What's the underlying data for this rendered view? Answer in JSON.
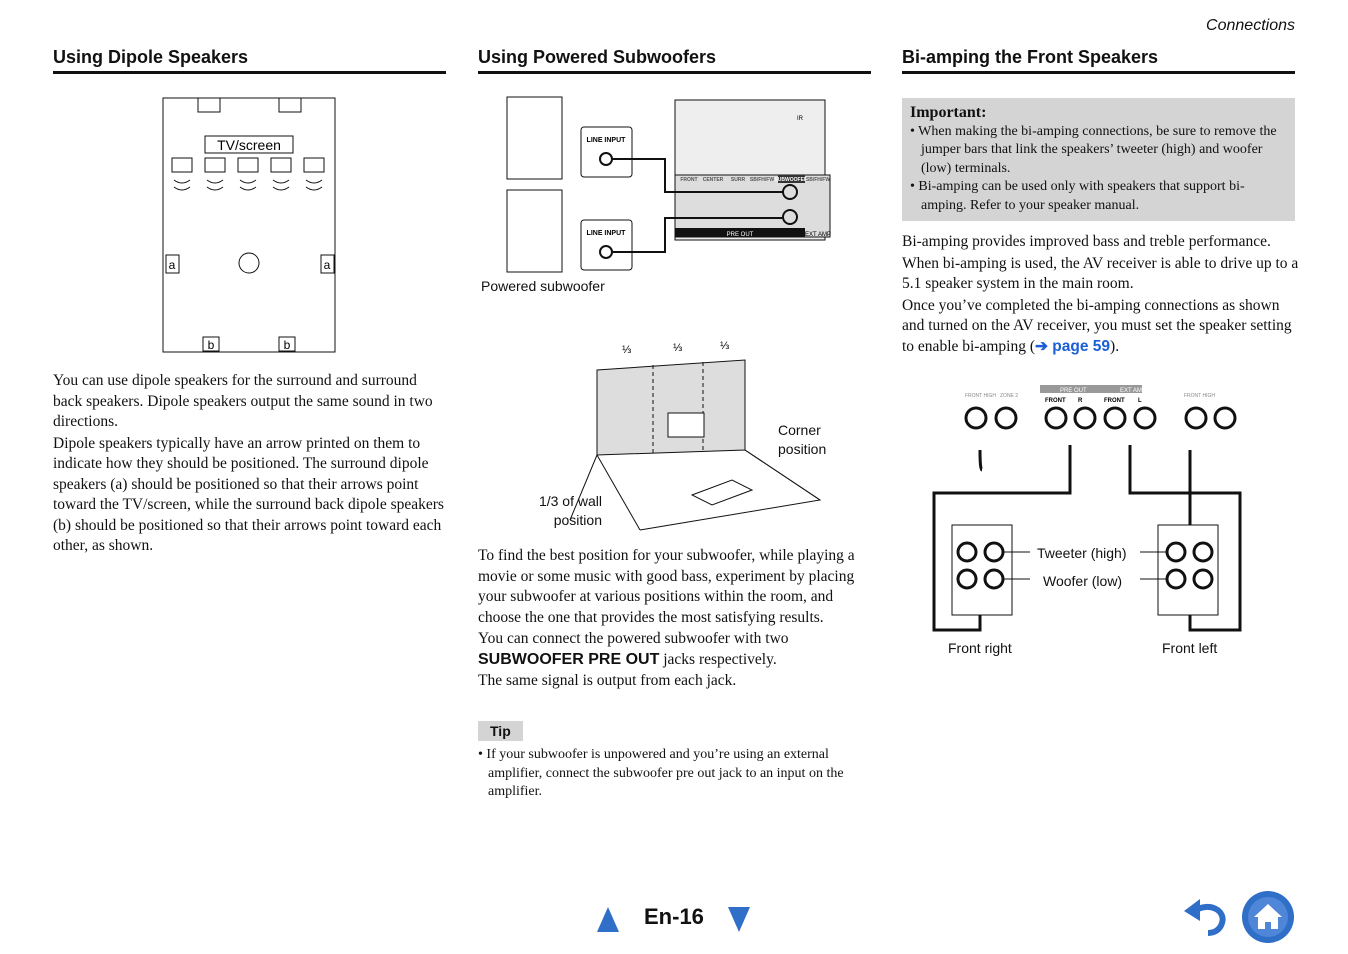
{
  "page": {
    "section": "Connections",
    "number": "En-16"
  },
  "colors": {
    "accent": "#1a5fd6",
    "note_bg": "#d4d4d4",
    "nav_blue": "#2f6fc8"
  },
  "dipole": {
    "title": "Using Dipole Speakers",
    "diagram": {
      "screen": "TV/screen",
      "label_a": "a",
      "label_b": "b"
    },
    "paragraphs": [
      "You can use dipole speakers for the surround and surround back speakers. Dipole speakers output the same sound in two directions.",
      "Dipole speakers typically have an arrow printed on them to indicate how they should be positioned. The surround dipole speakers (a) should be positioned so that their arrows point toward the TV/screen, while the surround back dipole speakers (b) should be positioned so that their arrows point toward each other, as shown."
    ]
  },
  "subwoofer": {
    "title": "Using Powered Subwoofers",
    "diagram": {
      "line_input": "LINE INPUT",
      "caption": "Powered subwoofer",
      "pre_out": "PRE OUT",
      "ext_amp": "EXT AMP",
      "ir": "IR",
      "jacks": [
        "FRONT",
        "CENTER",
        "SURR",
        "SB/FH/FW",
        "SUBWOOFER",
        "SB/FH/FW"
      ]
    },
    "room": {
      "third": "⅓",
      "corner": "Corner position",
      "wall": "1/3 of wall position"
    },
    "p1": "To find the best position for your subwoofer, while playing a movie or some music with good bass, experiment by placing your subwoofer at various positions within the room, and choose the one that provides the most satisfying results.",
    "p2_a": "You can connect the powered subwoofer with two ",
    "p2_bold": "SUBWOOFER PRE OUT",
    "p2_b": " jacks respectively.",
    "p3": "The same signal is output from each jack.",
    "tip_label": "Tip",
    "tip": "If your subwoofer is unpowered and you’re using an external amplifier, connect the subwoofer pre out jack to an input on the amplifier."
  },
  "biamp": {
    "title": "Bi-amping the Front Speakers",
    "important_label": "Important:",
    "important": [
      "When making the bi-amping connections, be sure to remove the jumper bars that link the speakers’ tweeter (high) and woofer (low) terminals.",
      "Bi-amping can be used only with speakers that support bi-amping. Refer to your speaker manual."
    ],
    "p1": "Bi-amping provides improved bass and treble performance.",
    "p2": "When bi-amping is used, the AV receiver is able to drive up to a 5.1 speaker system in the main room.",
    "p3_a": "Once you’ve completed the bi-amping connections as shown and turned on the AV receiver, you must set the speaker setting to enable bi-amping (",
    "p3_link": "➔ page 59",
    "p3_b": ").",
    "diagram": {
      "tweeter": "Tweeter (high)",
      "woofer": "Woofer (low)",
      "front_right": "Front right",
      "front_left": "Front left",
      "pre_out": "PRE OUT",
      "ext_amp": "EXT AMP",
      "front": "FRONT",
      "r": "R",
      "l": "L",
      "front_high": "FRONT HIGH",
      "zone": "ZONE 2",
      "bi_amp": "Bi-AMP"
    }
  },
  "nav": {
    "prev": "previous-page",
    "next": "next-page",
    "back": "back",
    "home": "home"
  }
}
